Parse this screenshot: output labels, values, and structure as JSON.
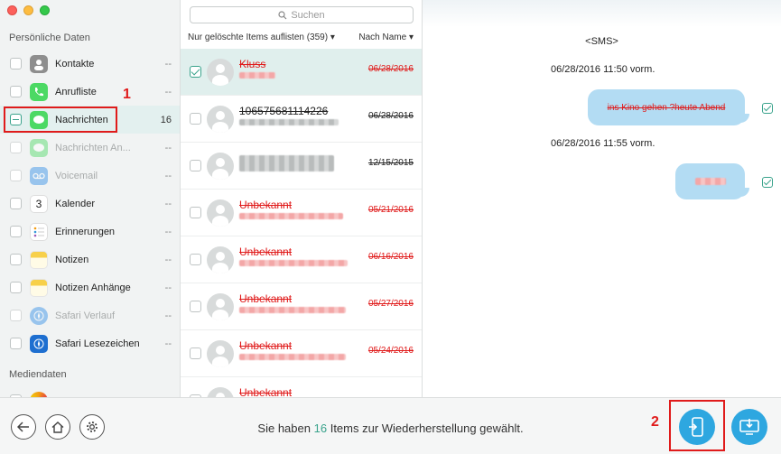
{
  "sidebar": {
    "section_personal": "Persönliche Daten",
    "section_media": "Mediendaten",
    "items": [
      {
        "label": "Kontakte",
        "count": "--",
        "icon": "contacts-icon",
        "color": "#8e8e8e"
      },
      {
        "label": "Anrufliste",
        "count": "--",
        "icon": "phone-icon",
        "color": "#4cd964"
      },
      {
        "label": "Nachrichten",
        "count": "16",
        "icon": "messages-icon",
        "color": "#4cd964"
      },
      {
        "label": "Nachrichten An...",
        "count": "--",
        "icon": "messages-attachment-icon",
        "color": "#4cd964"
      },
      {
        "label": "Voicemail",
        "count": "--",
        "icon": "voicemail-icon",
        "color": "#2e8ce6"
      },
      {
        "label": "Kalender",
        "count": "--",
        "icon": "calendar-icon",
        "color": "#ffffff",
        "icon_text": "3"
      },
      {
        "label": "Erinnerungen",
        "count": "--",
        "icon": "reminders-icon",
        "color": "#ffffff"
      },
      {
        "label": "Notizen",
        "count": "--",
        "icon": "notes-icon",
        "color": "#f7d04a"
      },
      {
        "label": "Notizen Anhänge",
        "count": "--",
        "icon": "notes-attachments-icon",
        "color": "#f7d04a"
      },
      {
        "label": "Safari Verlauf",
        "count": "--",
        "icon": "safari-icon",
        "color": "#2e8ce6"
      },
      {
        "label": "Safari Lesezeichen",
        "count": "--",
        "icon": "safari-bookmarks-icon",
        "color": "#1e6fd0"
      }
    ],
    "annotation_1": "1"
  },
  "list": {
    "search_placeholder": "Suchen",
    "filter_label": "Nur gelöschte Items auflisten (359)",
    "sort_label": "Nach Name",
    "rows": [
      {
        "name": "Kluss",
        "date": "06/28/2016",
        "deleted": true
      },
      {
        "name": "106575681114226",
        "date": "06/28/2016",
        "deleted": false
      },
      {
        "name": "",
        "date": "12/15/2015",
        "deleted": false
      },
      {
        "name": "Unbekannt",
        "date": "05/21/2016",
        "deleted": true
      },
      {
        "name": "Unbekannt",
        "date": "06/16/2016",
        "deleted": true
      },
      {
        "name": "Unbekannt",
        "date": "05/27/2016",
        "deleted": true
      },
      {
        "name": "Unbekannt",
        "date": "05/24/2016",
        "deleted": true
      },
      {
        "name": "Unbekannt",
        "date": "",
        "deleted": true
      }
    ]
  },
  "detail": {
    "title": "<SMS>",
    "timestamp_1": "06/28/2016 11:50 vorm.",
    "bubble_1": "ins Kino gehen ?heute Abend",
    "timestamp_2": "06/28/2016 11:55 vorm."
  },
  "bottom": {
    "status_prefix": "Sie haben",
    "status_count": "16",
    "status_suffix": "Items zur Wiederherstellung gewählt.",
    "annotation_2": "2"
  },
  "colors": {
    "accent": "#3aa38c",
    "deleted_red": "#e01b1b",
    "action_blue": "#2ea7e0"
  }
}
